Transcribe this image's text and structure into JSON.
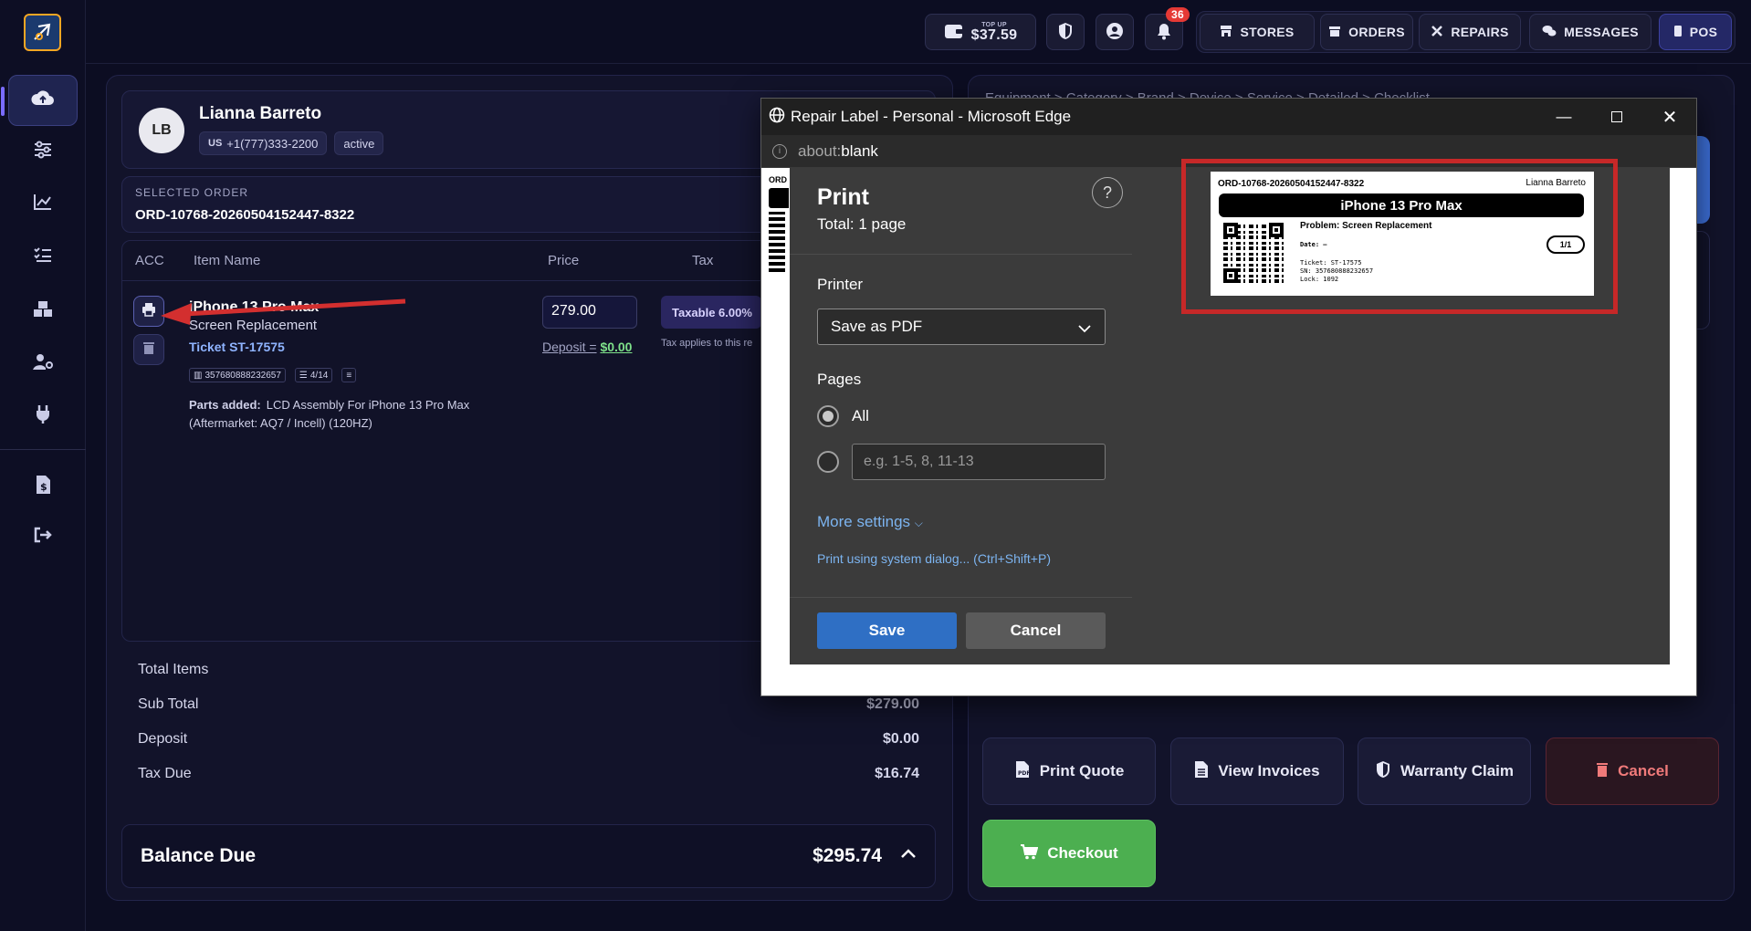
{
  "topbar": {
    "topup_label": "TOP UP",
    "balance": "$37.59",
    "notif_count": "36",
    "nav": [
      "STORES",
      "ORDERS",
      "REPAIRS",
      "MESSAGES",
      "POS"
    ]
  },
  "customer": {
    "initials": "LB",
    "name": "Lianna Barreto",
    "country": "US",
    "phone": "+1(777)333-2200",
    "status": "active"
  },
  "selected_order": {
    "label": "SELECTED ORDER",
    "id": "ORD-10768-20260504152447-8322"
  },
  "items": {
    "headers": [
      "ACC",
      "Item Name",
      "Price",
      "Tax"
    ],
    "row": {
      "name": "iPhone 13 Pro Max",
      "service": "Screen Replacement",
      "ticket": "Ticket ST-17575",
      "serial": "357680888232657",
      "checklist": "4/14",
      "parts_label": "Parts added:",
      "parts_value": "LCD Assembly For iPhone 13 Pro Max (Aftermarket: AQ7 / Incell) (120HZ)",
      "price": "279.00",
      "deposit_label": "Deposit =",
      "deposit_value": "$0.00",
      "tax_badge": "Taxable 6.00%",
      "tax_note": "Tax applies to this re"
    }
  },
  "summary": {
    "total_items_label": "Total Items",
    "subtotal_label": "Sub Total",
    "subtotal_value": "$279.00",
    "deposit_label": "Deposit",
    "deposit_value": "$0.00",
    "tax_label": "Tax Due",
    "tax_value": "$16.74",
    "balance_label": "Balance Due",
    "balance_value": "$295.74"
  },
  "right": {
    "breadcrumb": "Equipment > Category > Brand > Device > Service > Detailed > Checklist",
    "buttons": {
      "print_quote": "Print Quote",
      "view_invoices": "View Invoices",
      "warranty": "Warranty Claim",
      "cancel": "Cancel",
      "checkout": "Checkout"
    }
  },
  "edge": {
    "title": "Repair Label - Personal - Microsoft Edge",
    "address_prefix": "about:",
    "address_rest": "blank",
    "print": {
      "title": "Print",
      "total": "Total: 1 page",
      "printer_label": "Printer",
      "printer_value": "Save as PDF",
      "pages_label": "Pages",
      "pages_all": "All",
      "pages_placeholder": "e.g. 1-5, 8, 11-13",
      "more_settings": "More settings",
      "system_dialog": "Print using system dialog... (Ctrl+Shift+P)",
      "save": "Save",
      "cancel": "Cancel",
      "help": "?"
    },
    "label": {
      "order": "ORD-10768-20260504152447-8322",
      "customer": "Lianna Barreto",
      "device": "iPhone 13 Pro Max",
      "problem": "Problem: Screen Replacement",
      "date": "Date: —",
      "count": "1/1",
      "ticket": "Ticket: ST-17575",
      "sn": "SN: 357680888232657",
      "lock": "Lock: 1092"
    },
    "bg_preview_prefix": "ORD"
  },
  "colors": {
    "accent": "#7a6cff",
    "annotation_red": "#d32f2f",
    "checkout_green": "#4caf50",
    "save_blue": "#2f6fc4"
  }
}
